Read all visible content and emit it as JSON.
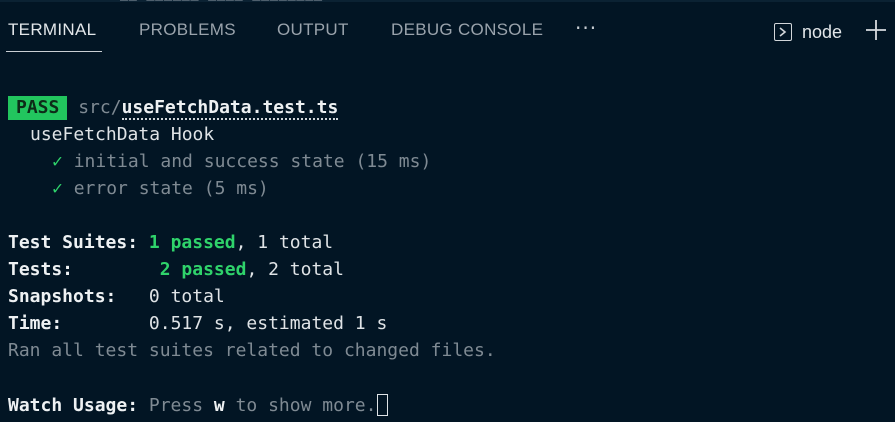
{
  "tabs": {
    "terminal": "TERMINAL",
    "problems": "PROBLEMS",
    "output": "OUTPUT",
    "debug_console": "DEBUG CONSOLE",
    "more": "···"
  },
  "toolbar": {
    "shell_name": "node"
  },
  "output": {
    "pass_badge": "PASS",
    "file_dir": "src/",
    "file_name": "useFetchData.test.ts",
    "suite_name": "useFetchData Hook",
    "tests": [
      {
        "check": "✓",
        "name": "initial and success state (15 ms)"
      },
      {
        "check": "✓",
        "name": "error state (5 ms)"
      }
    ],
    "summary": {
      "suites_label": "Test Suites:",
      "suites_passed": "1 passed",
      "suites_total": ", 1 total",
      "tests_label": "Tests:",
      "tests_passed": "2 passed",
      "tests_total": ", 2 total",
      "snapshots_label": "Snapshots:",
      "snapshots_value": "0 total",
      "time_label": "Time:",
      "time_value": "0.517 s, estimated 1 s",
      "ran_all": "Ran all test suites related to changed files."
    },
    "watch": {
      "label": "Watch Usage:",
      "press": " Press ",
      "key": "w",
      "rest": " to show more."
    }
  },
  "colors": {
    "background": "#021524",
    "pass_badge": "#22c55e",
    "passed_text": "#2fd36b"
  },
  "icons": {
    "shell": "terminal-icon",
    "new_terminal": "plus-icon"
  }
}
